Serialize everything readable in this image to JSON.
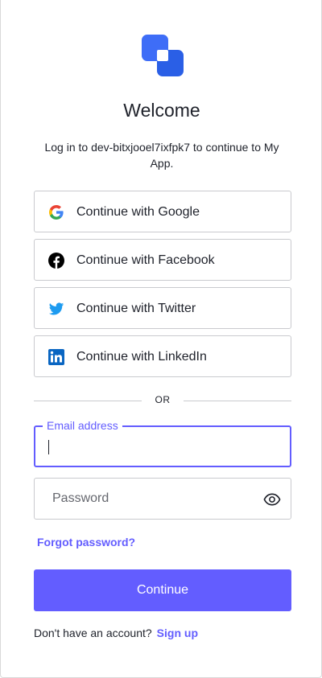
{
  "logo": {
    "icon": "overlapping-squares-logo",
    "colors": [
      "#3e6df7",
      "#2a5fe6"
    ]
  },
  "header": {
    "title": "Welcome",
    "subtitle": "Log in to dev-bitxjooel7ixfpk7 to continue to My App."
  },
  "social_buttons": [
    {
      "label": "Continue with Google",
      "icon": "google-icon"
    },
    {
      "label": "Continue with Facebook",
      "icon": "facebook-icon"
    },
    {
      "label": "Continue with Twitter",
      "icon": "twitter-icon"
    },
    {
      "label": "Continue with LinkedIn",
      "icon": "linkedin-icon"
    }
  ],
  "divider": {
    "text": "OR"
  },
  "email": {
    "label": "Email address",
    "value": ""
  },
  "password": {
    "placeholder": "Password",
    "value": "",
    "toggle_icon": "eye-icon"
  },
  "forgot_password": "Forgot password?",
  "continue_button": "Continue",
  "footer": {
    "prompt": "Don't have an account?",
    "signup_link": "Sign up"
  },
  "colors": {
    "accent": "#635dff",
    "text": "#1e212a",
    "border": "#c9cace"
  }
}
